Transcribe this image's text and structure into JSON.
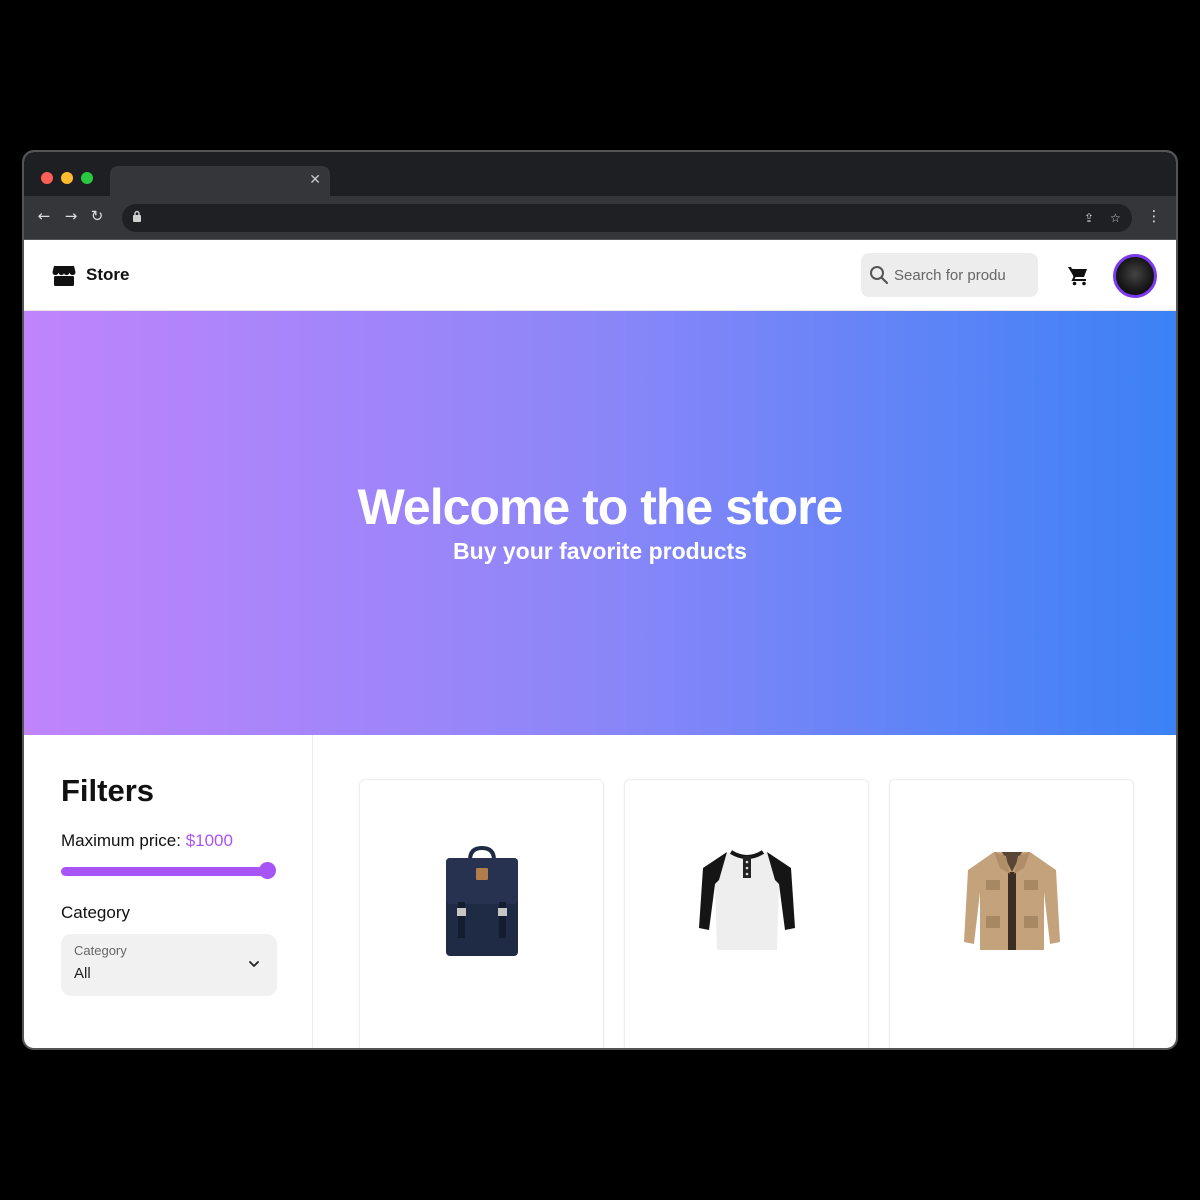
{
  "app": {
    "name": "Store"
  },
  "header": {
    "search_placeholder": "Search for produ"
  },
  "hero": {
    "title": "Welcome to the store",
    "subtitle": "Buy your favorite products"
  },
  "filters": {
    "title": "Filters",
    "max_price_label": "Maximum price: ",
    "max_price_value": "$1000",
    "slider_level_fraction": 1.0,
    "category_heading": "Category",
    "category_select": {
      "label": "Category",
      "value": "All"
    }
  },
  "products": [
    {
      "icon": "backpack-image"
    },
    {
      "icon": "henley-shirt-image"
    },
    {
      "icon": "jacket-image"
    }
  ],
  "colors": {
    "accent": "#a855f7",
    "avatar_ring": "#7c3aed",
    "hero_gradient_start": "#c084fc",
    "hero_gradient_end": "#3b82f6"
  }
}
